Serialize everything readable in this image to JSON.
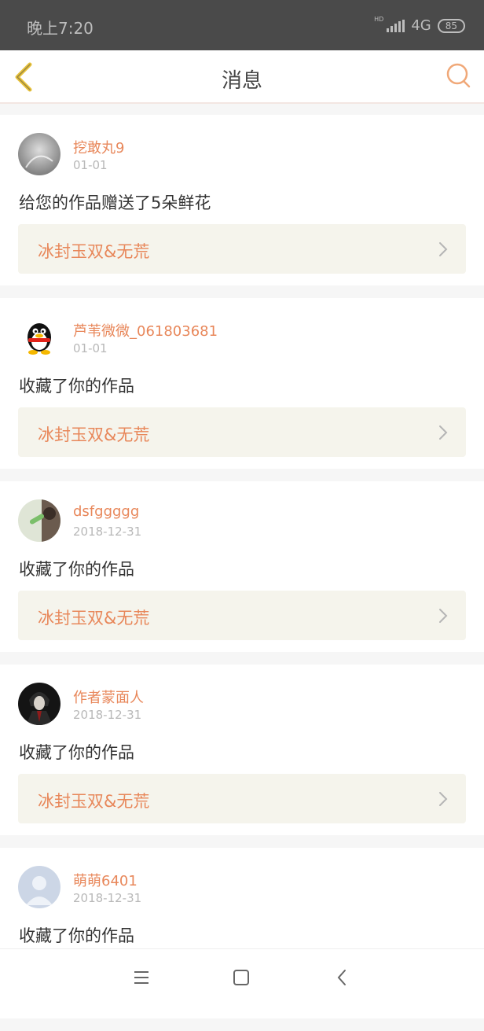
{
  "status_bar": {
    "time": "晚上7:20",
    "network": "4G",
    "hd": "HD",
    "battery": "85"
  },
  "header": {
    "title": "消息",
    "back_icon": "chevron-left-icon",
    "search_icon": "search-icon"
  },
  "colors": {
    "accent": "#e8875a",
    "back_icon_color": "#e8c23a",
    "card_link_bg": "#f5f4ec"
  },
  "messages": [
    {
      "user": "挖敢丸9",
      "date": "01-01",
      "action": "给您的作品赠送了5朵鲜花",
      "work": "冰封玉双&无荒"
    },
    {
      "user": "芦苇微微_061803681",
      "date": "01-01",
      "action": "收藏了你的作品",
      "work": "冰封玉双&无荒"
    },
    {
      "user": "dsfggggg",
      "date": "2018-12-31",
      "action": "收藏了你的作品",
      "work": "冰封玉双&无荒"
    },
    {
      "user": "作者蒙面人",
      "date": "2018-12-31",
      "action": "收藏了你的作品",
      "work": "冰封玉双&无荒"
    },
    {
      "user": "萌萌6401",
      "date": "2018-12-31",
      "action": "收藏了你的作品",
      "work": ""
    }
  ],
  "nav": {
    "menu_icon": "menu-icon",
    "home_icon": "home-square-icon",
    "back_icon": "back-icon"
  }
}
